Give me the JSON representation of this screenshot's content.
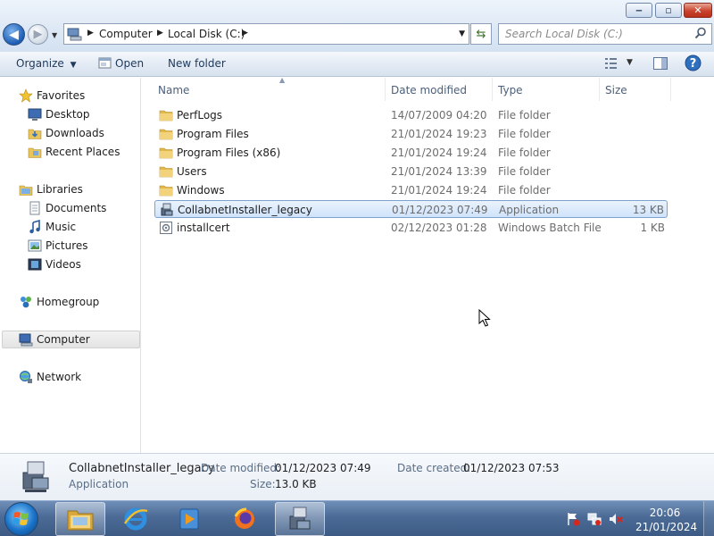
{
  "window": {
    "controls": {
      "minimize": "‒",
      "maximize": "▫",
      "close": "✕"
    }
  },
  "address_bar": {
    "crumbs": [
      "Computer",
      "Local Disk (C:)"
    ],
    "search_placeholder": "Search Local Disk (C:)"
  },
  "toolbar": {
    "organize": "Organize",
    "open": "Open",
    "new_folder": "New folder"
  },
  "nav": {
    "favorites": "Favorites",
    "desktop": "Desktop",
    "downloads": "Downloads",
    "recent_places": "Recent Places",
    "libraries": "Libraries",
    "documents": "Documents",
    "music": "Music",
    "pictures": "Pictures",
    "videos": "Videos",
    "homegroup": "Homegroup",
    "computer": "Computer",
    "network": "Network"
  },
  "columns": {
    "name": "Name",
    "date_modified": "Date modified",
    "type": "Type",
    "size": "Size"
  },
  "files": [
    {
      "name": "PerfLogs",
      "date": "14/07/2009 04:20",
      "type": "File folder",
      "size": "",
      "icon": "folder-icon"
    },
    {
      "name": "Program Files",
      "date": "21/01/2024 19:23",
      "type": "File folder",
      "size": "",
      "icon": "folder-icon"
    },
    {
      "name": "Program Files (x86)",
      "date": "21/01/2024 19:24",
      "type": "File folder",
      "size": "",
      "icon": "folder-icon"
    },
    {
      "name": "Users",
      "date": "21/01/2024 13:39",
      "type": "File folder",
      "size": "",
      "icon": "folder-icon"
    },
    {
      "name": "Windows",
      "date": "21/01/2024 19:24",
      "type": "File folder",
      "size": "",
      "icon": "folder-icon"
    },
    {
      "name": "CollabnetInstaller_legacy",
      "date": "01/12/2023 07:49",
      "type": "Application",
      "size": "13 KB",
      "icon": "installer-icon",
      "selected": true
    },
    {
      "name": "installcert",
      "date": "02/12/2023 01:28",
      "type": "Windows Batch File",
      "size": "1 KB",
      "icon": "batch-file-icon"
    }
  ],
  "details": {
    "name": "CollabnetInstaller_legacy",
    "type": "Application",
    "date_modified_label": "Date modified:",
    "date_modified": "01/12/2023 07:49",
    "date_created_label": "Date created:",
    "date_created": "01/12/2023 07:53",
    "size_label": "Size:",
    "size": "13.0 KB"
  },
  "taskbar": {
    "time": "20:06",
    "date": "21/01/2024"
  },
  "colors": {
    "selection_border": "#7da2ce",
    "selection_fill": "#cfe3fb",
    "taskbar": "#4b6b96",
    "close_button": "#c9432e",
    "link_text": "#1e395b"
  }
}
